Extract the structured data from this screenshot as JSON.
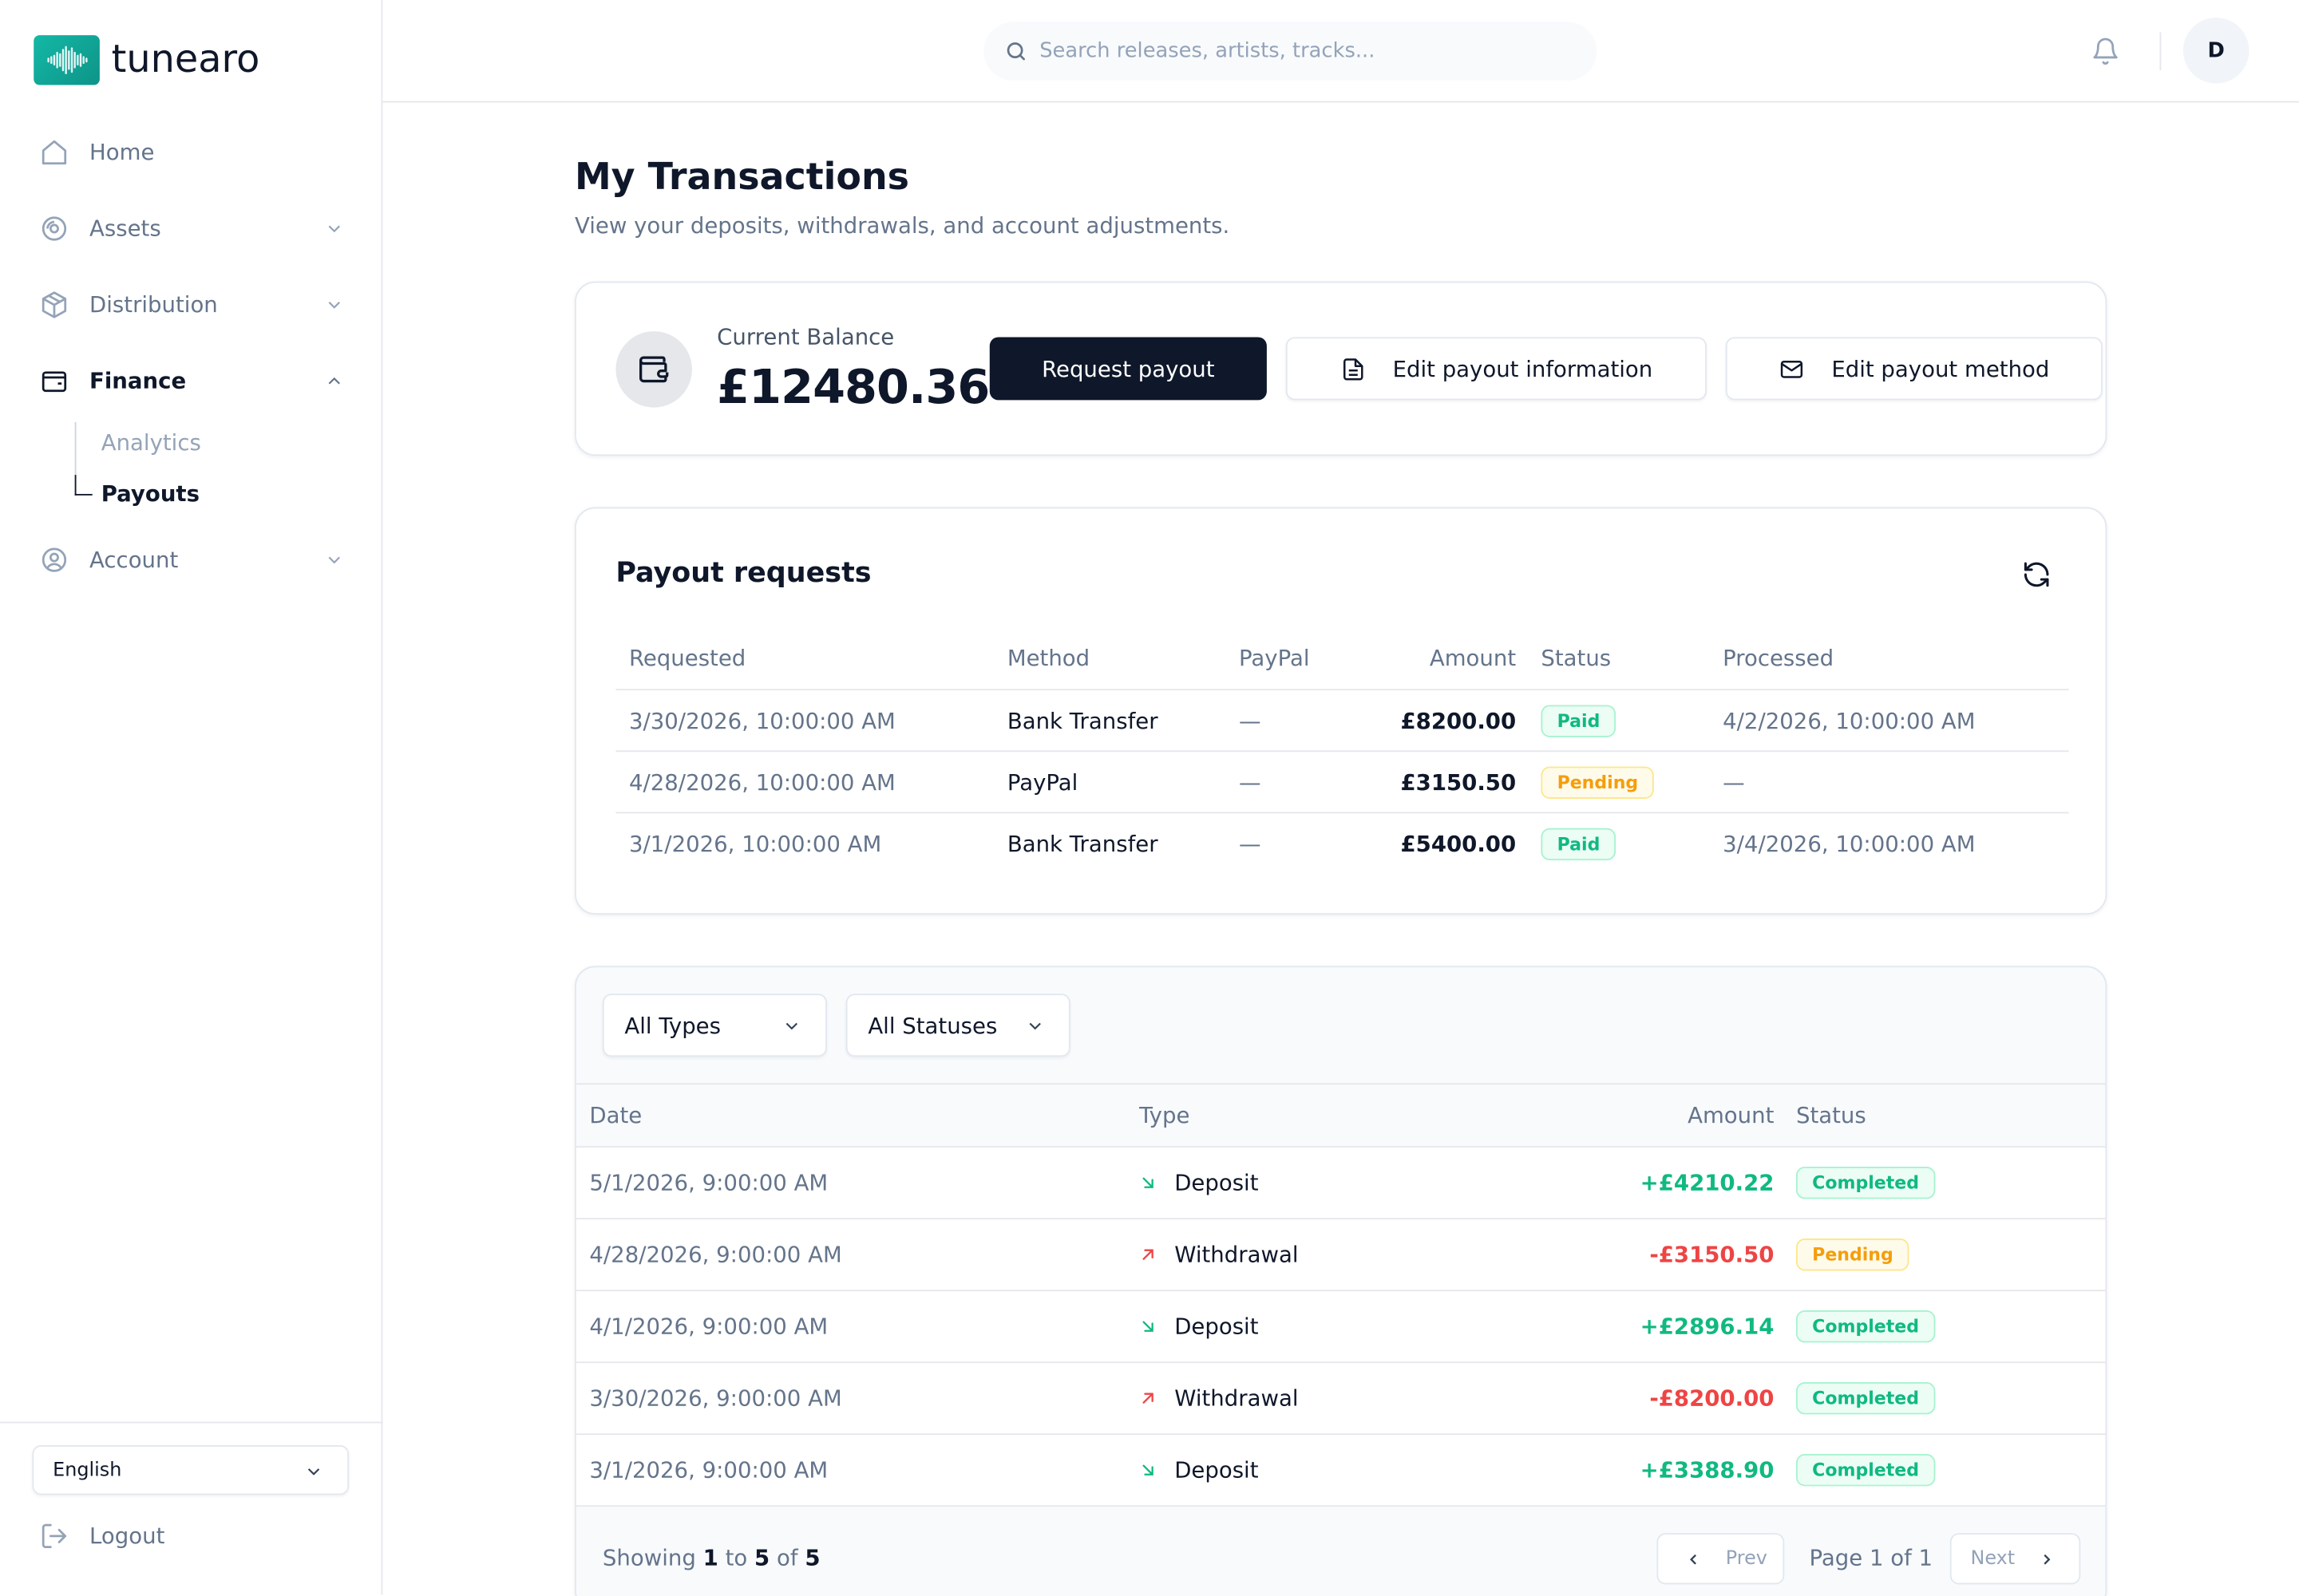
{
  "app": {
    "name": "tunearo"
  },
  "sidebar": {
    "items": [
      {
        "label": "Home"
      },
      {
        "label": "Assets"
      },
      {
        "label": "Distribution"
      },
      {
        "label": "Finance"
      },
      {
        "label": "Account"
      }
    ],
    "finance_sub": [
      {
        "label": "Analytics"
      },
      {
        "label": "Payouts"
      }
    ],
    "language": "English",
    "logout": "Logout"
  },
  "header": {
    "search_placeholder": "Search releases, artists, tracks...",
    "avatar_initial": "D"
  },
  "page": {
    "title": "My Transactions",
    "subtitle": "View your deposits, withdrawals, and account adjustments."
  },
  "balance": {
    "label": "Current Balance",
    "value": "£12480.36",
    "request_payout": "Request payout",
    "edit_info": "Edit payout information",
    "edit_method": "Edit payout method"
  },
  "payouts": {
    "title": "Payout requests",
    "columns": {
      "requested": "Requested",
      "method": "Method",
      "paypal": "PayPal",
      "amount": "Amount",
      "status": "Status",
      "processed": "Processed"
    },
    "rows": [
      {
        "requested": "3/30/2026, 10:00:00 AM",
        "method": "Bank Transfer",
        "paypal": "—",
        "amount": "£8200.00",
        "status": "Paid",
        "processed": "4/2/2026, 10:00:00 AM"
      },
      {
        "requested": "4/28/2026, 10:00:00 AM",
        "method": "PayPal",
        "paypal": "—",
        "amount": "£3150.50",
        "status": "Pending",
        "processed": "—"
      },
      {
        "requested": "3/1/2026, 10:00:00 AM",
        "method": "Bank Transfer",
        "paypal": "—",
        "amount": "£5400.00",
        "status": "Paid",
        "processed": "3/4/2026, 10:00:00 AM"
      }
    ]
  },
  "transactions": {
    "filter_type": "All Types",
    "filter_status": "All Statuses",
    "columns": {
      "date": "Date",
      "type": "Type",
      "amount": "Amount",
      "status": "Status"
    },
    "rows": [
      {
        "date": "5/1/2026, 9:00:00 AM",
        "type": "Deposit",
        "amount": "+£4210.22",
        "status": "Completed"
      },
      {
        "date": "4/28/2026, 9:00:00 AM",
        "type": "Withdrawal",
        "amount": "-£3150.50",
        "status": "Pending"
      },
      {
        "date": "4/1/2026, 9:00:00 AM",
        "type": "Deposit",
        "amount": "+£2896.14",
        "status": "Completed"
      },
      {
        "date": "3/30/2026, 9:00:00 AM",
        "type": "Withdrawal",
        "amount": "-£8200.00",
        "status": "Completed"
      },
      {
        "date": "3/1/2026, 9:00:00 AM",
        "type": "Deposit",
        "amount": "+£3388.90",
        "status": "Completed"
      }
    ],
    "pagination": {
      "showing_prefix": "Showing",
      "from": "1",
      "to_word": "to",
      "to": "5",
      "of_word": "of",
      "total": "5",
      "prev": "Prev",
      "page_info": "Page 1 of 1",
      "next": "Next"
    }
  },
  "colors": {
    "brand": "#14b8a6",
    "primary": "#0f172a",
    "positive": "#10b981",
    "negative": "#ef4444",
    "pending": "#f59e0b"
  }
}
